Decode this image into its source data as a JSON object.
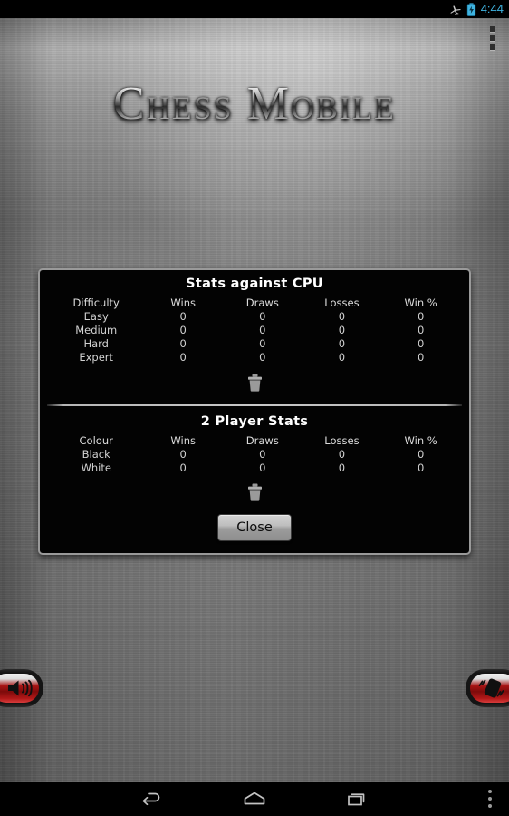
{
  "status_bar": {
    "airplane_icon": "airplane-mode-icon",
    "battery_icon": "battery-charging-icon",
    "time": "4:44",
    "time_color": "#3fb3e0"
  },
  "app": {
    "title": "Chess Mobile",
    "overflow_icon": "app-overflow-menu-icon"
  },
  "dialog": {
    "cpu_section": {
      "title": "Stats against CPU",
      "headers": [
        "Difficulty",
        "Wins",
        "Draws",
        "Losses",
        "Win %"
      ],
      "rows": [
        [
          "Easy",
          "0",
          "0",
          "0",
          "0"
        ],
        [
          "Medium",
          "0",
          "0",
          "0",
          "0"
        ],
        [
          "Hard",
          "0",
          "0",
          "0",
          "0"
        ],
        [
          "Expert",
          "0",
          "0",
          "0",
          "0"
        ]
      ],
      "clear_icon": "trash-icon"
    },
    "two_player_section": {
      "title": "2 Player Stats",
      "headers": [
        "Colour",
        "Wins",
        "Draws",
        "Losses",
        "Win %"
      ],
      "rows": [
        [
          "Black",
          "0",
          "0",
          "0",
          "0"
        ],
        [
          "White",
          "0",
          "0",
          "0",
          "0"
        ]
      ],
      "clear_icon": "trash-icon"
    },
    "close_label": "Close"
  },
  "controls": {
    "sound_icon": "sound-speaker-icon",
    "vibrate_icon": "vibrate-phone-icon",
    "accent_color": "#a81414"
  },
  "nav_bar": {
    "back_icon": "back-arrow-icon",
    "home_icon": "home-icon",
    "recents_icon": "recent-apps-icon",
    "overflow_icon": "nav-overflow-menu-icon"
  }
}
